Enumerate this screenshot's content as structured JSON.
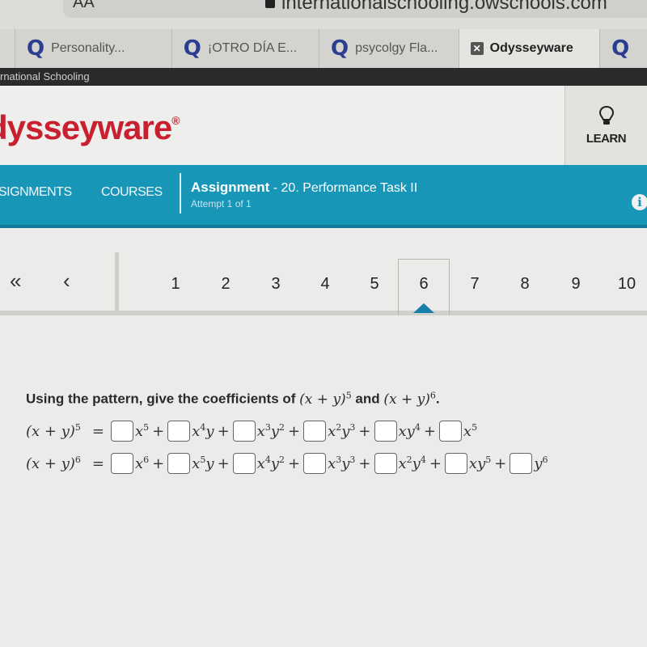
{
  "browser": {
    "reader_label": "AA",
    "url": "internationalschooling.owschools.com",
    "tabs": [
      {
        "icon": "quizlet-icon",
        "label": "Personality...",
        "active": false
      },
      {
        "icon": "quizlet-icon",
        "label": "¡OTRO DÍA E...",
        "active": false
      },
      {
        "icon": "quizlet-icon",
        "label": "psycolgy Fla...",
        "active": false
      },
      {
        "icon": "close-icon",
        "label": "Odysseyware",
        "active": true
      },
      {
        "icon": "quizlet-icon",
        "label": "",
        "active": false
      }
    ]
  },
  "school_bar": {
    "label": "rnational Schooling"
  },
  "header": {
    "logo": "dysseyware",
    "logo_mark": "®",
    "learn_label": "LEARN"
  },
  "nav": {
    "items": [
      "SIGNMENTS",
      "COURSES"
    ],
    "assignment_label": "Assignment",
    "assignment_name": " - 20. Performance Task II",
    "attempt": "Attempt 1 of 1",
    "info_glyph": "i"
  },
  "pager": {
    "first_glyph": "«",
    "prev_glyph": "‹",
    "pages": [
      "1",
      "2",
      "3",
      "4",
      "5",
      "6",
      "7",
      "8",
      "9",
      "10"
    ],
    "current": "6"
  },
  "question": {
    "prompt_start": "Using the pattern, give the coefficients of ",
    "expr1": "(x + y)",
    "exp1": "5",
    "and": " and ",
    "expr2": "(x + y)",
    "exp2": "6",
    "end": "."
  },
  "equations": [
    {
      "lhs": "(x + y)",
      "lhs_exp": "5",
      "terms": [
        {
          "base": "x",
          "exp": "5",
          "rest": "",
          "rest_exp": ""
        },
        {
          "base": "x",
          "exp": "4",
          "rest": "y",
          "rest_exp": ""
        },
        {
          "base": "x",
          "exp": "3",
          "rest": "y",
          "rest_exp": "2"
        },
        {
          "base": "x",
          "exp": "2",
          "rest": "y",
          "rest_exp": "3"
        },
        {
          "base": "x",
          "exp": "",
          "rest": "y",
          "rest_exp": "4"
        },
        {
          "base": "x",
          "exp": "5",
          "rest": "",
          "rest_exp": ""
        }
      ]
    },
    {
      "lhs": "(x + y)",
      "lhs_exp": "6",
      "terms": [
        {
          "base": "x",
          "exp": "6",
          "rest": "",
          "rest_exp": ""
        },
        {
          "base": "x",
          "exp": "5",
          "rest": "y",
          "rest_exp": ""
        },
        {
          "base": "x",
          "exp": "4",
          "rest": "y",
          "rest_exp": "2"
        },
        {
          "base": "x",
          "exp": "3",
          "rest": "y",
          "rest_exp": "3"
        },
        {
          "base": "x",
          "exp": "2",
          "rest": "y",
          "rest_exp": "4"
        },
        {
          "base": "x",
          "exp": "",
          "rest": "y",
          "rest_exp": "5"
        },
        {
          "base": "y",
          "exp": "6",
          "rest": "",
          "rest_exp": ""
        }
      ]
    }
  ],
  "colors": {
    "brand_red": "#c8202f",
    "nav_blue": "#1796b8",
    "caret_blue": "#1780aa",
    "quizlet_blue": "#2a3d8f"
  }
}
